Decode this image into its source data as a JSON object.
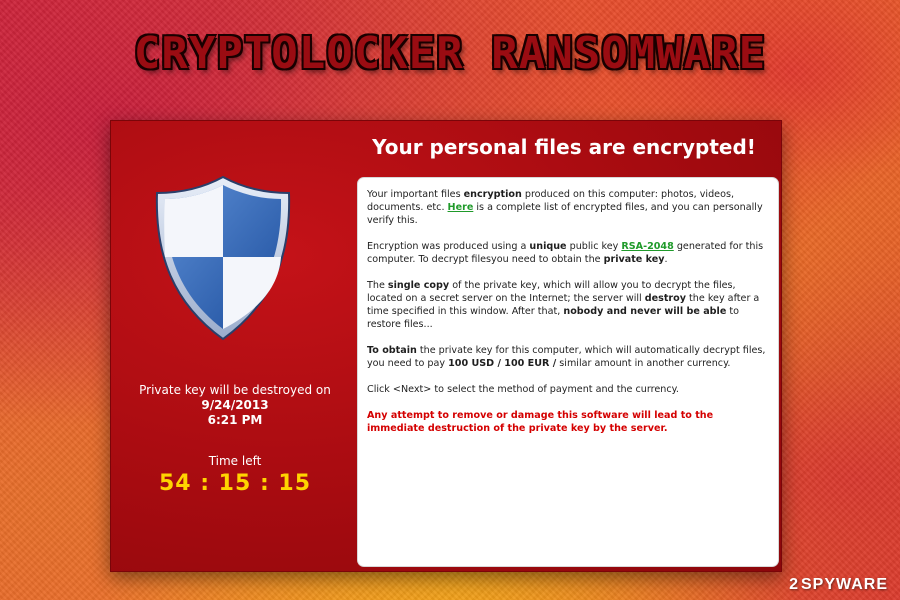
{
  "headline": "CRYPTOLOCKER RANSOMWARE",
  "window": {
    "title": "Your personal files are encrypted!",
    "left": {
      "destroy_text": "Private key will be destroyed on",
      "destroy_date": "9/24/2013",
      "destroy_time": "6:21 PM",
      "time_left_label": "Time left",
      "timer": "54 : 15 : 15",
      "shield_icon": "shield-icon"
    },
    "panel": {
      "p1_a": "Your important files ",
      "p1_b": "encryption",
      "p1_c": " produced on this computer: photos, videos, documents. etc. ",
      "p1_link": "Here",
      "p1_d": " is a complete list of encrypted files, and you can personally verify this.",
      "p2_a": "Encryption was produced using a ",
      "p2_b": "unique",
      "p2_c": " public key ",
      "p2_link": "RSA-2048",
      "p2_d": " generated for this computer. To decrypt filesyou need to obtain the ",
      "p2_e": "private key",
      "p2_f": ".",
      "p3_a": "The ",
      "p3_b": "single copy",
      "p3_c": " of the private key, which will allow you to decrypt the files, located on a secret server on the Internet; the server will ",
      "p3_d": "destroy",
      "p3_e": " the key after a time specified in this window. After that, ",
      "p3_f": "nobody and never will be able",
      "p3_g": " to restore files...",
      "p4_a": "To obtain",
      "p4_b": " the private key for this computer, which will automatically decrypt files, you need to pay ",
      "p4_c": "100 USD / 100 EUR /",
      "p4_d": "  similar amount in another currency.",
      "p5": "Click <Next> to select the method of payment and the currency.",
      "warning": "Any attempt to remove or damage this software will lead to the immediate destruction of the private key by the server."
    }
  },
  "watermark": {
    "prefix": "2",
    "text": "SPYWAR",
    "suffix": "E"
  },
  "colors": {
    "window_red": "#b00d12",
    "timer_yellow": "#ffd400",
    "link_green": "#1f9a2a",
    "warning_red": "#d40000"
  }
}
